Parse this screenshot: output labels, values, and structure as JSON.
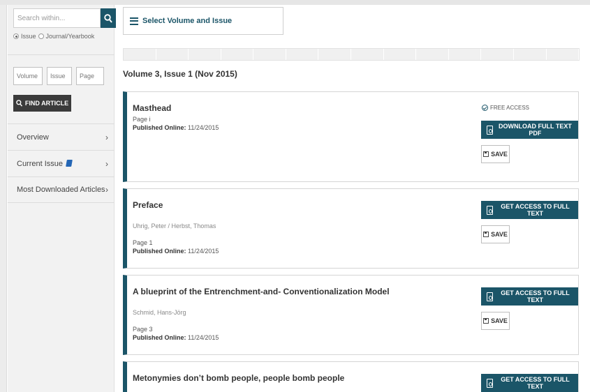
{
  "sidebar": {
    "search": {
      "placeholder": "Search within..."
    },
    "radios": [
      {
        "label": "Issue",
        "selected": true
      },
      {
        "label": "Journal/Yearbook",
        "selected": false
      }
    ],
    "volume_placeholder": "Volume",
    "issue_placeholder": "Issue",
    "page_placeholder": "Page",
    "find_label": "FIND ARTICLE",
    "nav": [
      {
        "label": "Overview",
        "chevron": "›"
      },
      {
        "label": "Current Issue",
        "chevron": "›"
      },
      {
        "label": "Most Downloaded Articles",
        "chevron": "›"
      }
    ]
  },
  "main": {
    "select_volume_label": "Select Volume and Issue",
    "issue_title": "Volume 3, Issue 1 (Nov 2015)",
    "articles": [
      {
        "title": "Masthead",
        "authors": "",
        "page": "Page i",
        "published_label": "Published Online:",
        "published_date": "11/24/2015",
        "free_access": "FREE ACCESS",
        "primary_button": "DOWNLOAD FULL TEXT PDF",
        "save": "SAVE"
      },
      {
        "title": "Preface",
        "authors": "Uhrig, Peter / Herbst, Thomas",
        "page": "Page 1",
        "published_label": "Published Online:",
        "published_date": "11/24/2015",
        "primary_button": "GET ACCESS TO FULL TEXT",
        "save": "SAVE"
      },
      {
        "title": "A blueprint of the Entrenchment-and- Conventionalization Model",
        "authors": "Schmid, Hans-Jörg",
        "page": "Page 3",
        "published_label": "Published Online:",
        "published_date": "11/24/2015",
        "primary_button": "GET ACCESS TO FULL TEXT",
        "save": "SAVE"
      },
      {
        "title": "Metonymies don’t bomb people, people bomb people",
        "primary_button": "GET ACCESS TO FULL TEXT"
      }
    ]
  },
  "colors": {
    "accent": "#1b5568",
    "find_button": "#3b3b3b",
    "sidebar_bg": "#f2f2f2"
  }
}
